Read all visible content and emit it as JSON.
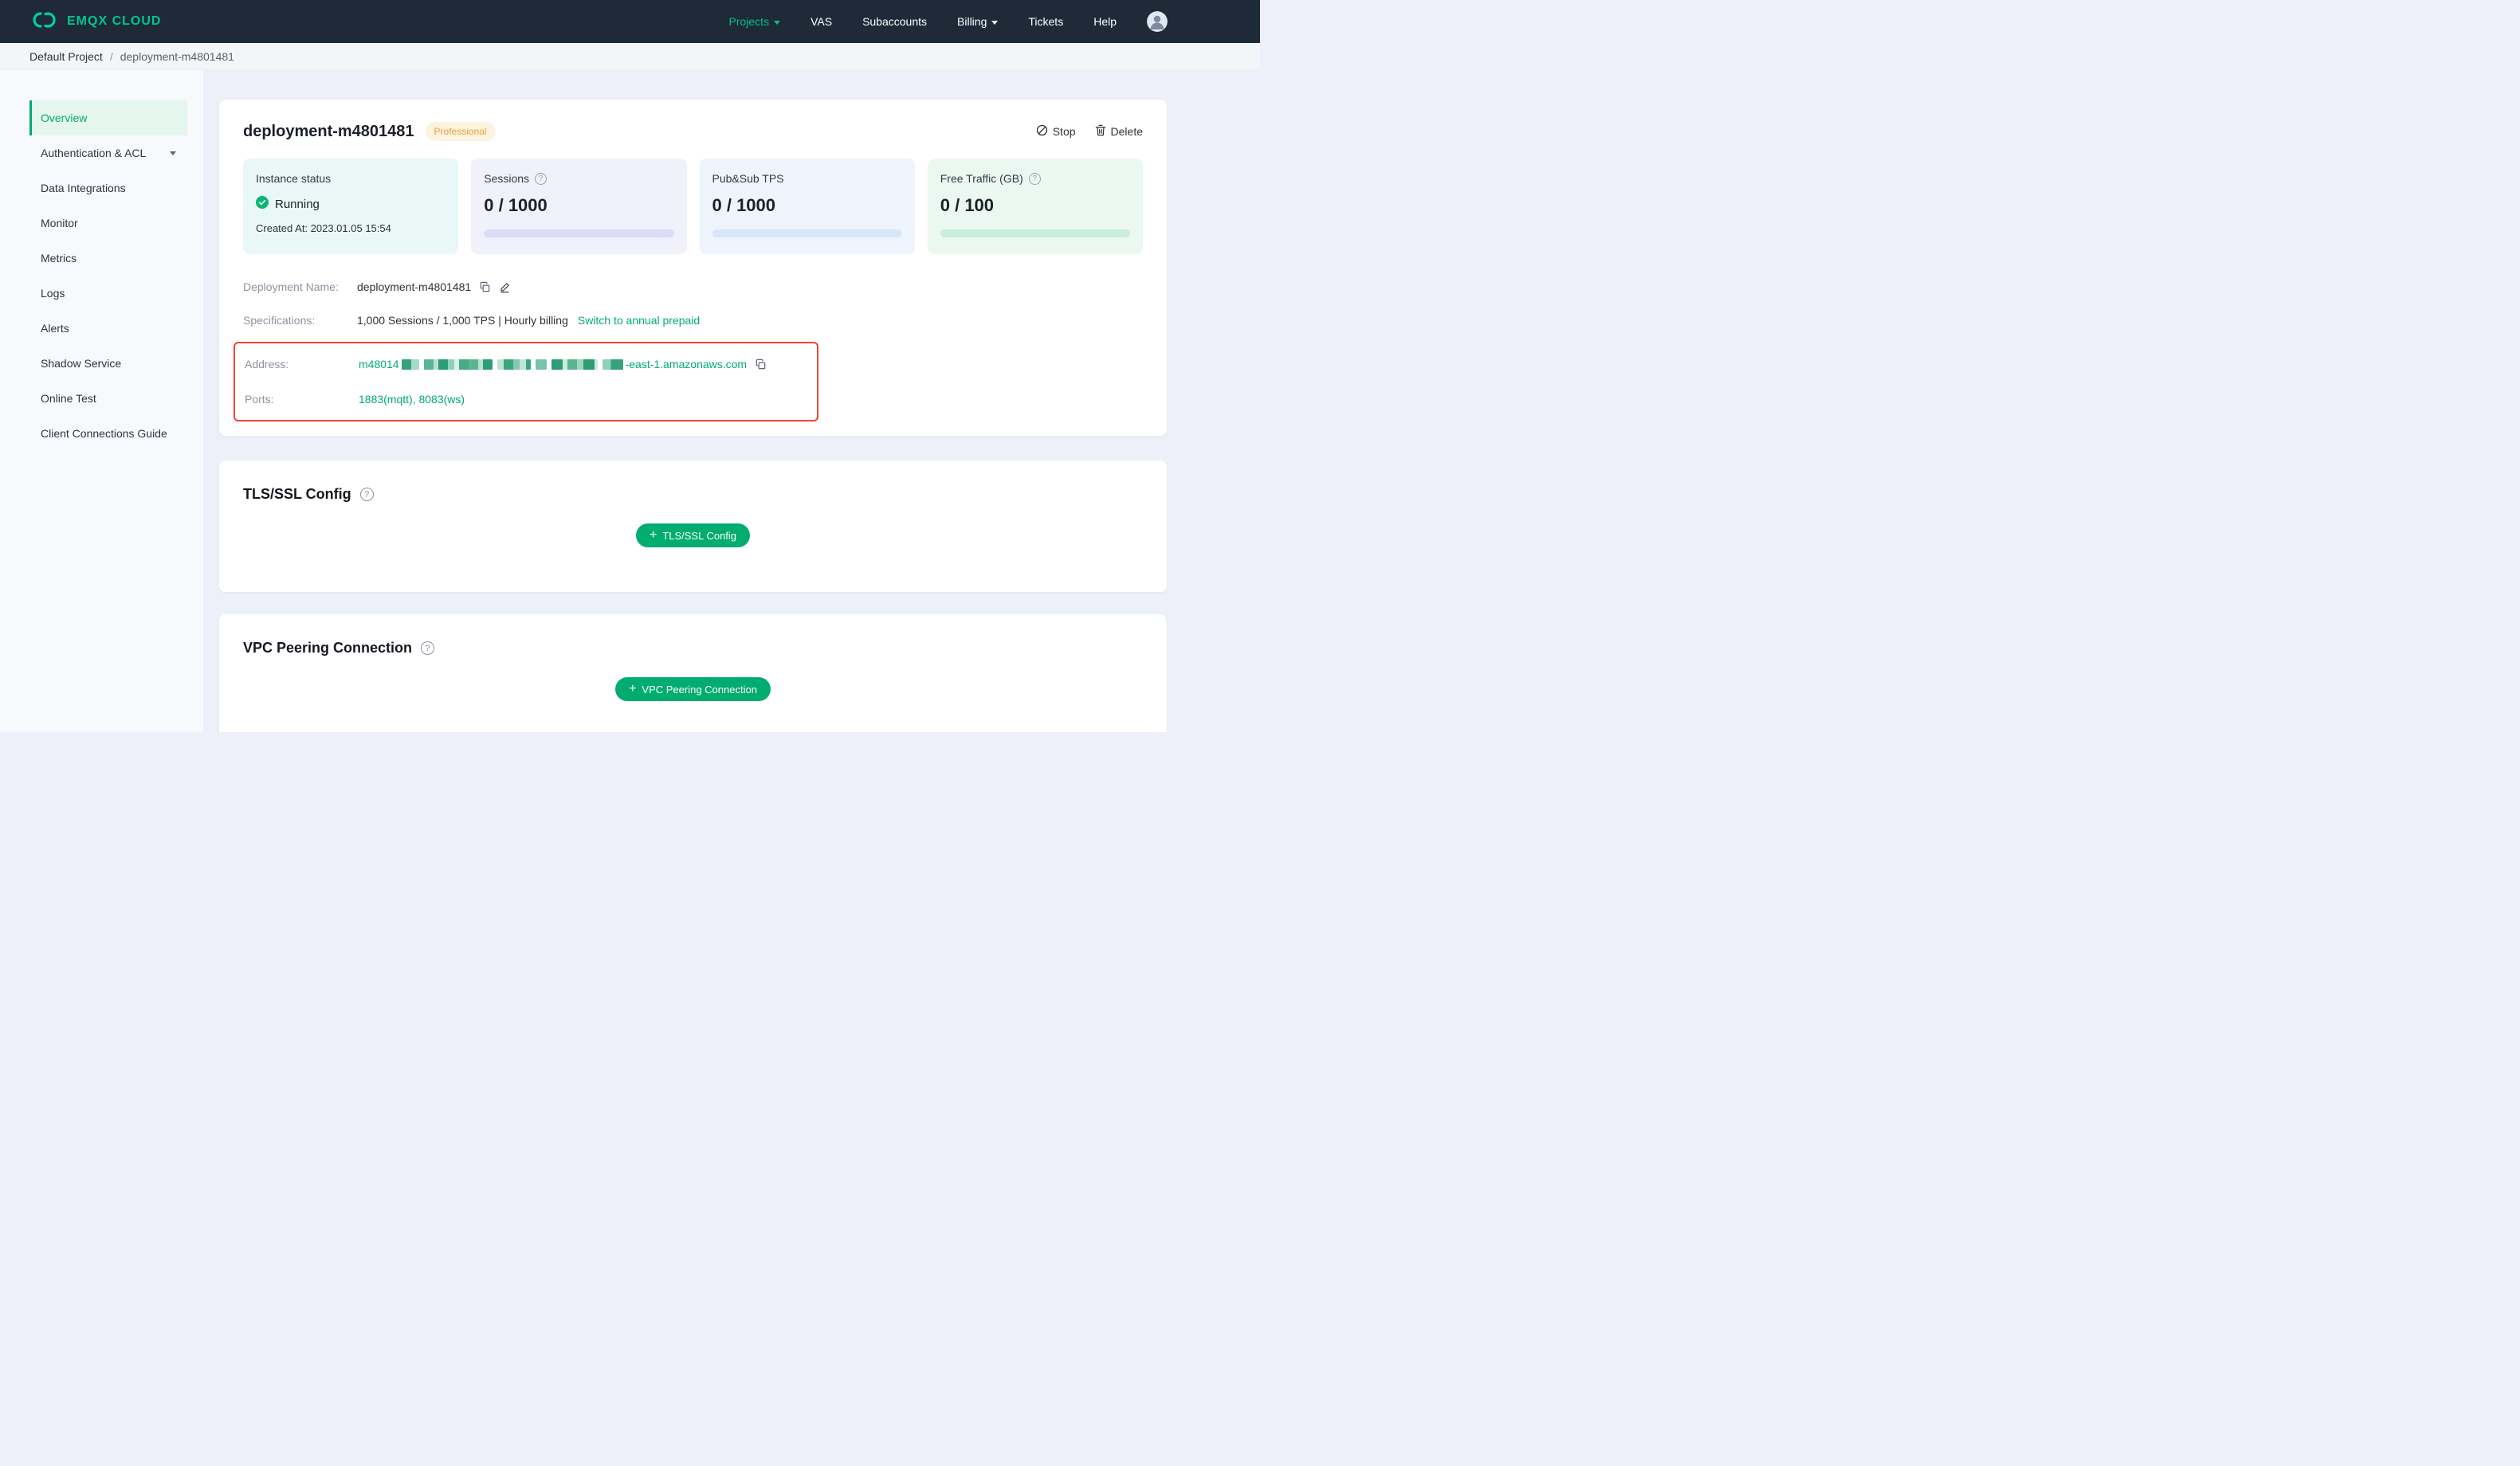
{
  "navbar": {
    "brand": "EMQX CLOUD",
    "items": [
      {
        "label": "Projects"
      },
      {
        "label": "VAS"
      },
      {
        "label": "Subaccounts"
      },
      {
        "label": "Billing"
      },
      {
        "label": "Tickets"
      },
      {
        "label": "Help"
      }
    ]
  },
  "breadcrumb": {
    "project": "Default Project",
    "separator": "/",
    "deployment": "deployment-m4801481"
  },
  "sidebar": {
    "items": [
      {
        "label": "Overview"
      },
      {
        "label": "Authentication & ACL"
      },
      {
        "label": "Data Integrations"
      },
      {
        "label": "Monitor"
      },
      {
        "label": "Metrics"
      },
      {
        "label": "Logs"
      },
      {
        "label": "Alerts"
      },
      {
        "label": "Shadow Service"
      },
      {
        "label": "Online Test"
      },
      {
        "label": "Client Connections Guide"
      }
    ]
  },
  "deployment": {
    "title": "deployment-m4801481",
    "plan_badge": "Professional",
    "stop_label": "Stop",
    "delete_label": "Delete",
    "stats": {
      "instance": {
        "label": "Instance status",
        "status": "Running",
        "created_at": "Created At: 2023.01.05 15:54"
      },
      "sessions": {
        "label": "Sessions",
        "value": "0 / 1000"
      },
      "tps": {
        "label": "Pub&Sub TPS",
        "value": "0 / 1000"
      },
      "traffic": {
        "label": "Free Traffic (GB)",
        "value": "0 / 100"
      }
    },
    "info": {
      "name_label": "Deployment Name:",
      "name_value": "deployment-m4801481",
      "spec_label": "Specifications:",
      "spec_value": "1,000 Sessions / 1,000 TPS | Hourly billing",
      "spec_link": "Switch to annual prepaid",
      "address_label": "Address:",
      "address_prefix": "m48014",
      "address_redacted": true,
      "address_suffix": "-east-1.amazonaws.com",
      "ports_label": "Ports:",
      "ports_value": "1883(mqtt), 8083(ws)"
    }
  },
  "tls_section": {
    "title": "TLS/SSL Config",
    "button_label": "TLS/SSL Config"
  },
  "vpc_section": {
    "title": "VPC Peering Connection",
    "button_label": "VPC Peering Connection"
  },
  "colors": {
    "accent_green": "#00ac70",
    "navbar_bg": "#1e2a38",
    "badge_orange": "#ed9f35",
    "annotation_red": "#f5432e",
    "status_check_green": "#0cb574"
  }
}
